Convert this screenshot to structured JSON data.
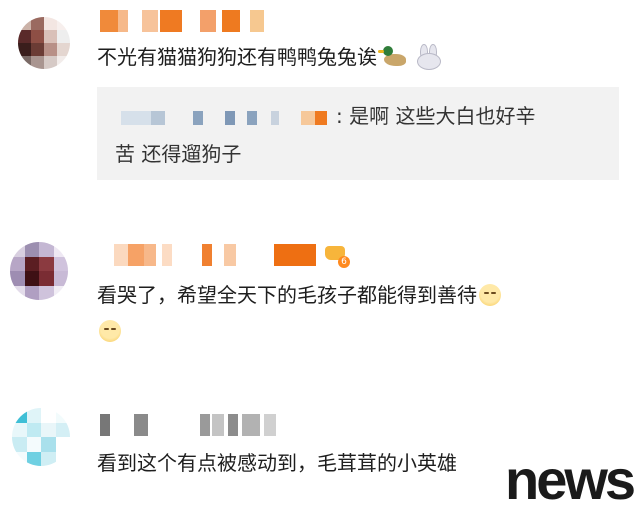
{
  "comments": [
    {
      "text": "不光有猫猫狗狗还有鸭鸭兔兔诶",
      "emojis": [
        "duck-icon",
        "rabbit-face-icon"
      ],
      "reply": {
        "line1": ": 是啊 这些大白也好辛",
        "line2": "苦 还得遛狗子"
      }
    },
    {
      "text_line1": "看哭了，希望全天下的毛孩子都能得到善待",
      "emojis": [
        "blush-smile-icon",
        "blush-smile-icon"
      ],
      "badge": "6"
    },
    {
      "text": "看到这个有点被感动到，毛茸茸的小英雄"
    }
  ],
  "watermark": "news",
  "colors": {
    "accent_orange": "#f07a1a",
    "reply_bg": "#f2f2f2",
    "text": "#1e1e1e"
  }
}
